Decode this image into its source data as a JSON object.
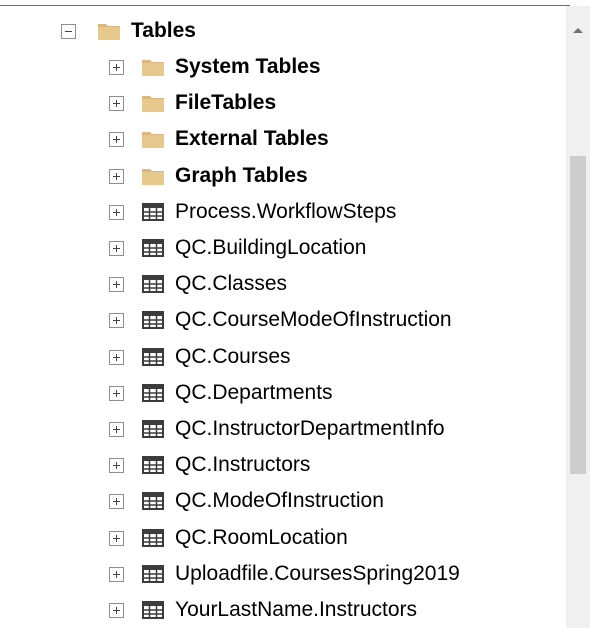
{
  "tree": {
    "root": {
      "label": "Tables",
      "expanded": true,
      "icon": "folder-icon"
    },
    "items": [
      {
        "label": "System Tables",
        "icon": "folder-icon"
      },
      {
        "label": "FileTables",
        "icon": "folder-icon"
      },
      {
        "label": "External Tables",
        "icon": "folder-icon"
      },
      {
        "label": "Graph Tables",
        "icon": "folder-icon"
      },
      {
        "label": "Process.WorkflowSteps",
        "icon": "table-icon"
      },
      {
        "label": "QC.BuildingLocation",
        "icon": "table-icon"
      },
      {
        "label": "QC.Classes",
        "icon": "table-icon"
      },
      {
        "label": "QC.CourseModeOfInstruction",
        "icon": "table-icon"
      },
      {
        "label": "QC.Courses",
        "icon": "table-icon"
      },
      {
        "label": "QC.Departments",
        "icon": "table-icon"
      },
      {
        "label": "QC.InstructorDepartmentInfo",
        "icon": "table-icon"
      },
      {
        "label": "QC.Instructors",
        "icon": "table-icon"
      },
      {
        "label": "QC.ModeOfInstruction",
        "icon": "table-icon"
      },
      {
        "label": "QC.RoomLocation",
        "icon": "table-icon"
      },
      {
        "label": "Uploadfile.CoursesSpring2019",
        "icon": "table-icon"
      },
      {
        "label": "YourLastName.Instructors",
        "icon": "table-icon"
      }
    ]
  },
  "colors": {
    "folder": "#dcb67a",
    "table_icon": "#3c3c3c",
    "scroll_track": "#f0f0f0",
    "scroll_thumb": "#cdcdcd"
  },
  "icons": {
    "collapse": "collapse-minus-icon",
    "expand": "expand-plus-icon",
    "scroll_up": "scroll-up-arrow-icon"
  }
}
